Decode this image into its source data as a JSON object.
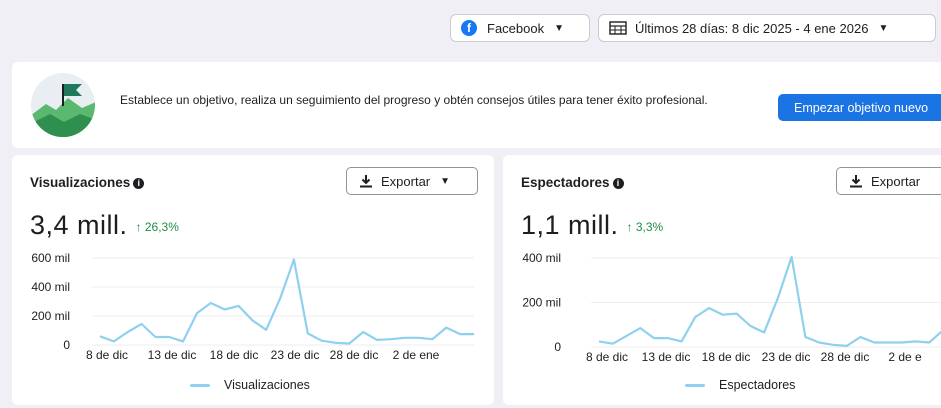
{
  "topbar": {
    "platform_label": "Facebook",
    "date_range_label": "Últimos 28 días: 8 dic 2025 - 4 ene 2026"
  },
  "goal": {
    "text": "Establece un objetivo, realiza un seguimiento del progreso y obtén consejos útiles para tener éxito profesional.",
    "button_label": "Empezar objetivo nuevo"
  },
  "colors": {
    "accent": "#1b74e4",
    "positive": "#1e8c45",
    "series": "#8fd0ef"
  },
  "panels": [
    {
      "title": "Visualizaciones",
      "export_label": "Exportar",
      "value": "3,4 mill.",
      "delta": "↑ 26,3%"
    },
    {
      "title": "Espectadores",
      "export_label": "Exportar",
      "value": "1,1 mill.",
      "delta": "↑ 3,3%"
    }
  ],
  "chart_data": [
    {
      "type": "line",
      "x_tick_labels": [
        "8 de dic",
        "13 de dic",
        "18 de dic",
        "23 de dic",
        "28 de dic",
        "2 de ene"
      ],
      "y_tick_labels": [
        "0",
        "200 mil",
        "400 mil",
        "600 mil"
      ],
      "ylim": [
        0,
        600000
      ],
      "series": [
        {
          "name": "Visualizaciones",
          "values": [
            60000,
            25000,
            90000,
            145000,
            55000,
            55000,
            25000,
            220000,
            290000,
            245000,
            270000,
            170000,
            105000,
            320000,
            590000,
            80000,
            30000,
            15000,
            10000,
            90000,
            35000,
            40000,
            50000,
            50000,
            40000,
            120000,
            75000,
            75000
          ]
        }
      ]
    },
    {
      "type": "line",
      "x_tick_labels": [
        "8 de dic",
        "13 de dic",
        "18 de dic",
        "23 de dic",
        "28 de dic",
        "2 de e"
      ],
      "y_tick_labels": [
        "0",
        "200 mil",
        "400 mil"
      ],
      "ylim": [
        0,
        400000
      ],
      "series": [
        {
          "name": "Espectadores",
          "values": [
            25000,
            15000,
            50000,
            85000,
            40000,
            40000,
            25000,
            135000,
            175000,
            145000,
            150000,
            95000,
            65000,
            220000,
            405000,
            45000,
            20000,
            10000,
            5000,
            45000,
            20000,
            20000,
            20000,
            25000,
            20000,
            75000
          ]
        }
      ]
    }
  ]
}
